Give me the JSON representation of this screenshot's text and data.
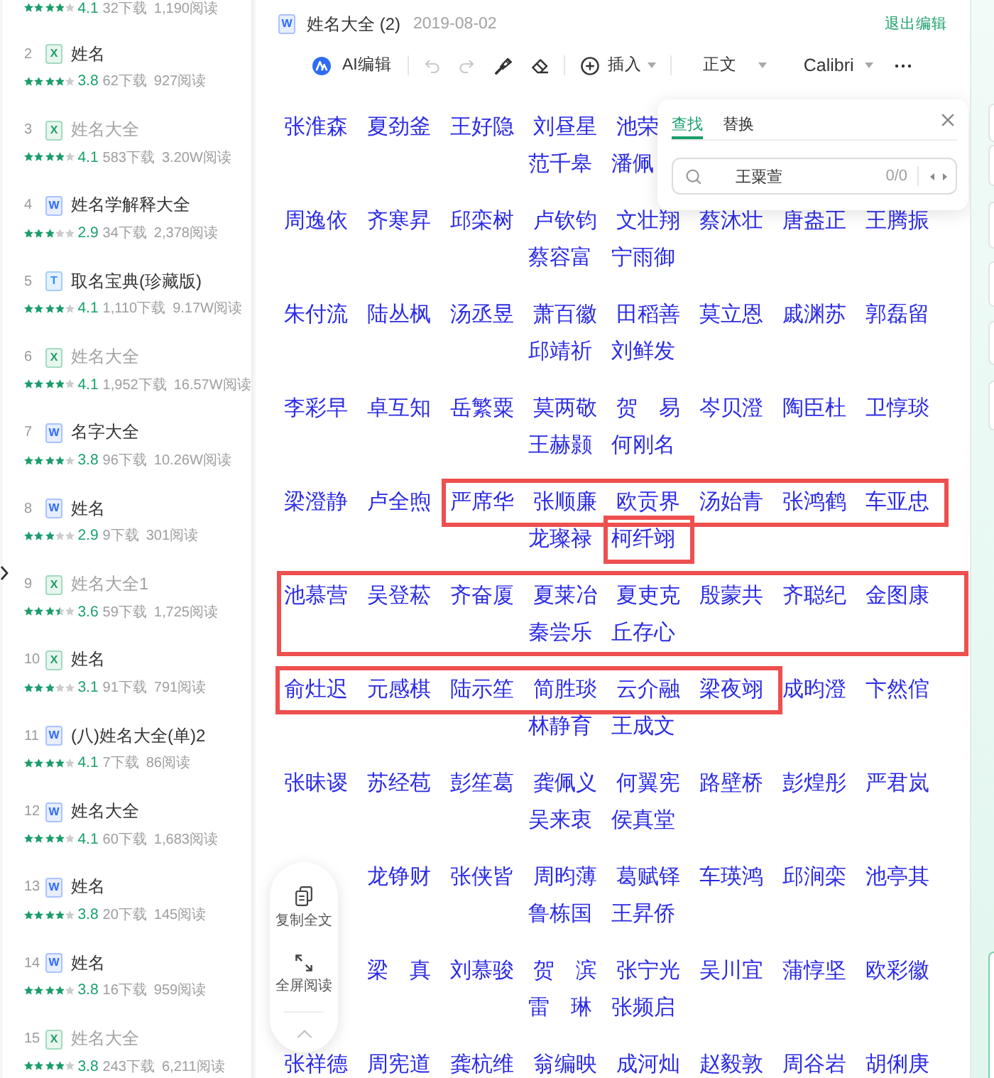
{
  "sidebar": {
    "items": [
      {
        "stars": 4,
        "rating": "4.1",
        "downloads": "32下载",
        "reads": "1,190阅读"
      },
      {
        "rank": "2",
        "kind": "sheet",
        "type_letter": "X",
        "title": "姓名",
        "visited": false,
        "stars": 4,
        "rating": "3.8",
        "downloads": "62下载",
        "reads": "927阅读"
      },
      {
        "rank": "3",
        "kind": "sheet",
        "type_letter": "X",
        "title": "姓名大全",
        "visited": true,
        "stars": 4,
        "rating": "4.1",
        "downloads": "583下载",
        "reads": "3.20W阅读"
      },
      {
        "rank": "4",
        "kind": "doc",
        "type_letter": "W",
        "title": "姓名学解释大全",
        "visited": false,
        "stars": 3,
        "rating": "2.9",
        "downloads": "34下载",
        "reads": "2,378阅读"
      },
      {
        "rank": "5",
        "kind": "text",
        "type_letter": "T",
        "title": "取名宝典(珍藏版)",
        "visited": false,
        "stars": 4,
        "rating": "4.1",
        "downloads": "1,110下载",
        "reads": "9.17W阅读"
      },
      {
        "rank": "6",
        "kind": "sheet",
        "type_letter": "X",
        "title": "姓名大全",
        "visited": true,
        "stars": 4,
        "rating": "4.1",
        "downloads": "1,952下载",
        "reads": "16.57W阅读"
      },
      {
        "rank": "7",
        "kind": "doc",
        "type_letter": "W",
        "title": "名字大全",
        "visited": false,
        "stars": 4,
        "rating": "3.8",
        "downloads": "96下载",
        "reads": "10.26W阅读"
      },
      {
        "rank": "8",
        "kind": "doc",
        "type_letter": "W",
        "title": "姓名",
        "visited": false,
        "stars": 3,
        "rating": "2.9",
        "downloads": "9下载",
        "reads": "301阅读"
      },
      {
        "rank": "9",
        "kind": "sheet",
        "type_letter": "X",
        "title": "姓名大全1",
        "visited": true,
        "stars": 3.5,
        "rating": "3.6",
        "downloads": "59下载",
        "reads": "1,725阅读"
      },
      {
        "rank": "10",
        "kind": "sheet",
        "type_letter": "X",
        "title": "姓名",
        "visited": false,
        "stars": 3,
        "rating": "3.1",
        "downloads": "91下载",
        "reads": "791阅读"
      },
      {
        "rank": "11",
        "kind": "doc",
        "type_letter": "W",
        "title": "(八)姓名大全(单)2",
        "visited": false,
        "stars": 4,
        "rating": "4.1",
        "downloads": "7下载",
        "reads": "86阅读"
      },
      {
        "rank": "12",
        "kind": "doc",
        "type_letter": "W",
        "title": "姓名大全",
        "visited": false,
        "stars": 4,
        "rating": "4.1",
        "downloads": "60下载",
        "reads": "1,683阅读"
      },
      {
        "rank": "13",
        "kind": "doc",
        "type_letter": "W",
        "title": "姓名",
        "visited": false,
        "stars": 4,
        "rating": "3.8",
        "downloads": "20下载",
        "reads": "145阅读"
      },
      {
        "rank": "14",
        "kind": "doc",
        "type_letter": "W",
        "title": "姓名",
        "visited": false,
        "stars": 4,
        "rating": "3.8",
        "downloads": "16下载",
        "reads": "959阅读"
      },
      {
        "rank": "15",
        "kind": "sheet",
        "type_letter": "X",
        "title": "姓名大全",
        "visited": true,
        "stars": 4,
        "rating": "3.8",
        "downloads": "243下载",
        "reads": "6,211阅读"
      }
    ]
  },
  "header": {
    "kind": "doc",
    "type_letter": "W",
    "title": "姓名大全 (2)",
    "date": "2019-08-02",
    "exit_label": "退出编辑"
  },
  "toolbar": {
    "ai_label": "AI编辑",
    "undo_disabled": true,
    "redo_disabled": true,
    "insert_label": "插入",
    "style": "正文",
    "font": "Calibri"
  },
  "find_panel": {
    "tabs": [
      {
        "label": "查找",
        "selected": true
      },
      {
        "label": "替换",
        "selected": false
      }
    ],
    "query": "王粟萱",
    "count": "0/0"
  },
  "paragraphs": [
    {
      "boxed": false,
      "start_hidden": false,
      "lines": [
        [
          {
            "boxed": false,
            "names": [
              "张淮森",
              "夏劲釜",
              "王好隐",
              "刘昼星",
              "池荣"
            ]
          }
        ],
        [
          {
            "boxed": false,
            "names": [
              "范千皋",
              "潘佩"
            ]
          }
        ]
      ]
    },
    {
      "boxed": false,
      "start_hidden": false,
      "lines": [
        [
          {
            "boxed": false,
            "names": [
              "周逸依",
              "齐寒昇",
              "邱栾树",
              "卢钦钧",
              "文壮翔",
              "蔡沐壮",
              "唐盎正",
              "王腾振"
            ]
          }
        ],
        [
          {
            "boxed": false,
            "names": [
              "蔡容富",
              "宁雨御"
            ]
          }
        ]
      ]
    },
    {
      "boxed": false,
      "start_hidden": false,
      "lines": [
        [
          {
            "boxed": false,
            "names": [
              "朱付流",
              "陆丛枫",
              "汤丞昱",
              "萧百徽",
              "田稻善",
              "莫立恩",
              "戚渊苏",
              "郭磊留"
            ]
          }
        ],
        [
          {
            "boxed": false,
            "names": [
              "邱靖祈",
              "刘鲜发"
            ]
          }
        ]
      ]
    },
    {
      "boxed": false,
      "start_hidden": false,
      "lines": [
        [
          {
            "boxed": false,
            "names": [
              "李彩早",
              "卓互知",
              "岳繁粟",
              "莫两敬",
              "贺　易",
              "岑贝澄",
              "陶臣杜",
              "卫惇琰"
            ]
          }
        ],
        [
          {
            "boxed": false,
            "names": [
              "王赫颢",
              "何刚名"
            ]
          }
        ]
      ]
    },
    {
      "boxed": false,
      "start_hidden": false,
      "lines": [
        [
          {
            "boxed": false,
            "names": [
              "梁澄静",
              "卢全煦"
            ]
          },
          {
            "boxed": true,
            "names": [
              "严席华",
              "张顺廉",
              "欧贡界",
              "汤始青",
              "张鸿鹤",
              "车亚忠"
            ]
          }
        ],
        [
          {
            "boxed": false,
            "names": [
              "龙璨禄"
            ]
          },
          {
            "boxed": true,
            "names": [
              "柯纤翊"
            ]
          }
        ]
      ]
    },
    {
      "boxed": true,
      "start_hidden": false,
      "lines": [
        [
          {
            "boxed": false,
            "names": [
              "池慕营",
              "吴登菘",
              "齐奋厦",
              "夏莱冶",
              "夏吏克",
              "殷蒙共",
              "齐聪纪",
              "金图康"
            ]
          }
        ],
        [
          {
            "boxed": false,
            "names": [
              "秦尝乐",
              "丘存心"
            ]
          }
        ]
      ]
    },
    {
      "boxed": false,
      "start_hidden": false,
      "lines": [
        [
          {
            "boxed": true,
            "names": [
              "俞灶迟",
              "元感棋",
              "陆示笙",
              "简胜琰",
              "云介融",
              "梁夜翊"
            ]
          },
          {
            "boxed": false,
            "names": [
              "成昀澄",
              "卞然倌"
            ]
          }
        ],
        [
          {
            "boxed": false,
            "names": [
              "林静育",
              "王成文"
            ]
          }
        ]
      ]
    },
    {
      "boxed": false,
      "start_hidden": false,
      "lines": [
        [
          {
            "boxed": false,
            "names": [
              "张昧谡",
              "苏经苞",
              "彭笙葛",
              "龚佩义",
              "何翼宪",
              "路壁桥",
              "彭煌彤",
              "严君岚"
            ]
          }
        ],
        [
          {
            "boxed": false,
            "names": [
              "吴来衷",
              "侯真堂"
            ]
          }
        ]
      ]
    },
    {
      "boxed": false,
      "start_hidden": true,
      "lines": [
        [
          {
            "boxed": false,
            "names": [
              "龙铮财",
              "张侠皆",
              "周昀薄",
              "葛赋铎",
              "车瑛鸿",
              "邱涧栾",
              "池亭其"
            ]
          }
        ],
        [
          {
            "boxed": false,
            "names": [
              "鲁栋国",
              "王昇侨"
            ]
          }
        ]
      ]
    },
    {
      "boxed": false,
      "start_hidden": true,
      "lines": [
        [
          {
            "boxed": false,
            "names": [
              "梁　真",
              "刘慕骏",
              "贺　滨",
              "张宁光",
              "吴川宜",
              "蒲惇坚",
              "欧彩徽"
            ]
          }
        ],
        [
          {
            "boxed": false,
            "names": [
              "雷　琳",
              "张频启"
            ]
          }
        ]
      ]
    },
    {
      "boxed": false,
      "start_hidden": false,
      "lines": [
        [
          {
            "boxed": false,
            "names": [
              "张祥德",
              "周宪道",
              "龚杭维",
              "翁编映",
              "成河灿",
              "赵毅敦",
              "周谷岩",
              "胡俐庚"
            ]
          }
        ]
      ]
    }
  ],
  "floating_tools": [
    {
      "kind": "copy",
      "label": "复制全文"
    },
    {
      "kind": "fullscreen",
      "label": "全屏阅读"
    }
  ]
}
